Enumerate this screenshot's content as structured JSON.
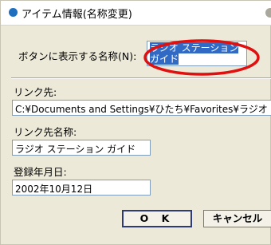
{
  "window": {
    "title": "アイテム情報(名称変更)"
  },
  "button_name": {
    "label": "ボタンに表示する名称(N):",
    "value": "ラジオ ステーション ガイド"
  },
  "link": {
    "label": "リンク先:",
    "value": "C:¥Documents and Settings¥ひたち¥Favorites¥ラジオ"
  },
  "link_name": {
    "label": "リンク先名称:",
    "value": "ラジオ ステーション ガイド"
  },
  "date": {
    "label": "登録年月日:",
    "value": "2002年10月12日"
  },
  "buttons": {
    "ok": "O K",
    "cancel": "キャンセル"
  },
  "colors": {
    "selection": "#316ac5",
    "highlight_ring": "#e01010",
    "title_icon": "#1f6fbf"
  },
  "icons": {
    "title": "blue-circle-icon",
    "close": "close-icon"
  }
}
